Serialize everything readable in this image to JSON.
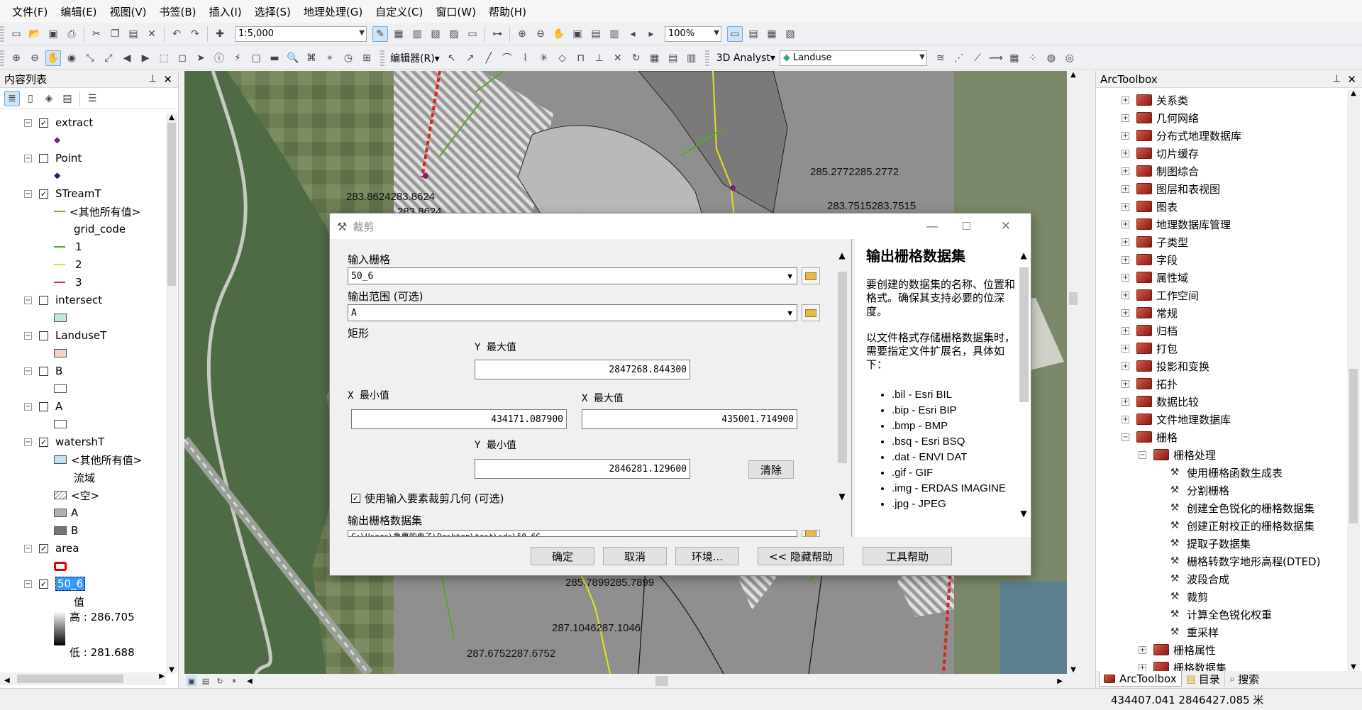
{
  "menu": [
    "文件(F)",
    "编辑(E)",
    "视图(V)",
    "书签(B)",
    "插入(I)",
    "选择(S)",
    "地理处理(G)",
    "自定义(C)",
    "窗口(W)",
    "帮助(H)"
  ],
  "toolbar": {
    "scale": "1:5,000",
    "zoom": "100%",
    "editor": "编辑器(R)▾",
    "analyst": "3D Analyst▾",
    "layer": "Landuse"
  },
  "toc": {
    "title": "内容列表",
    "layers": [
      {
        "name": "extract",
        "checked": true
      },
      {
        "name": "Point",
        "checked": false
      },
      {
        "name": "STreamT",
        "checked": true,
        "legend": [
          "<其他所有值>",
          "grid_code",
          "1",
          "2",
          "3"
        ]
      },
      {
        "name": "intersect",
        "checked": false
      },
      {
        "name": "LanduseT",
        "checked": false
      },
      {
        "name": "B",
        "checked": false
      },
      {
        "name": "A",
        "checked": false
      },
      {
        "name": "watershT",
        "checked": true,
        "legend": [
          "<其他所有值>",
          "流域",
          "<空>",
          "A",
          "B"
        ]
      },
      {
        "name": "area",
        "checked": true
      },
      {
        "name": "50_6",
        "checked": true,
        "legend": [
          "值",
          "高 : 286.705",
          "低 : 281.688"
        ]
      }
    ]
  },
  "map_labels": [
    "283.8624283.8624",
    "283.8624",
    "285.2772285.2772",
    "283.7515283.7515",
    "285.7899285.7899",
    "287.1046287.1046",
    "287.6752287.6752"
  ],
  "dialog": {
    "title": "裁剪",
    "input_raster_label": "输入栅格",
    "input_raster": "50_6",
    "extent_label": "输出范围 (可选)",
    "extent": "A",
    "rect_label": "矩形",
    "ymax_label": "Y 最大值",
    "ymax": "2847268.844300",
    "xmin_label": "X 最小值",
    "xmin": "434171.087900",
    "xmax_label": "X 最大值",
    "xmax": "435001.714900",
    "ymin_label": "Y 最小值",
    "ymin": "2846281.129600",
    "clear": "清除",
    "use_geom": "使用输入要素裁剪几何 (可选)",
    "output_label": "输出栅格数据集",
    "output": "C:\\Users\\鲁惠的电子\\Desktop\\test\\sds\\50_6C",
    "buttons": [
      "确定",
      "取消",
      "环境...",
      "<< 隐藏帮助",
      "工具帮助"
    ],
    "help_title": "输出栅格数据集",
    "help_p1": "要创建的数据集的名称、位置和格式。确保其支持必要的位深度。",
    "help_p2": "以文件格式存储栅格数据集时，需要指定文件扩展名，具体如下：",
    "help_list": [
      ".bil - Esri BIL",
      ".bip - Esri BIP",
      ".bmp - BMP",
      ".bsq - Esri BSQ",
      ".dat - ENVI DAT",
      ".gif - GIF",
      ".img - ERDAS IMAGINE",
      ".jpg - JPEG"
    ]
  },
  "arctoolbox": {
    "title": "ArcToolbox",
    "items": [
      "关系类",
      "几何网络",
      "分布式地理数据库",
      "切片缓存",
      "制图综合",
      "图层和表视图",
      "图表",
      "地理数据库管理",
      "子类型",
      "字段",
      "属性域",
      "工作空间",
      "常规",
      "归档",
      "打包",
      "投影和变换",
      "拓扑",
      "数据比较",
      "文件地理数据库",
      "栅格"
    ],
    "sub": "栅格处理",
    "tools": [
      "使用栅格函数生成表",
      "分割栅格",
      "创建全色锐化的栅格数据集",
      "创建正射校正的栅格数据集",
      "提取子数据集",
      "栅格转数字地形高程(DTED)",
      "波段合成",
      "裁剪",
      "计算全色锐化权重",
      "重采样"
    ],
    "after": [
      "栅格属性",
      "栅格数据集"
    ],
    "tabs": [
      "ArcToolbox",
      "目录",
      "搜索"
    ]
  },
  "status": {
    "coords": "434407.041  2846427.085 米"
  }
}
